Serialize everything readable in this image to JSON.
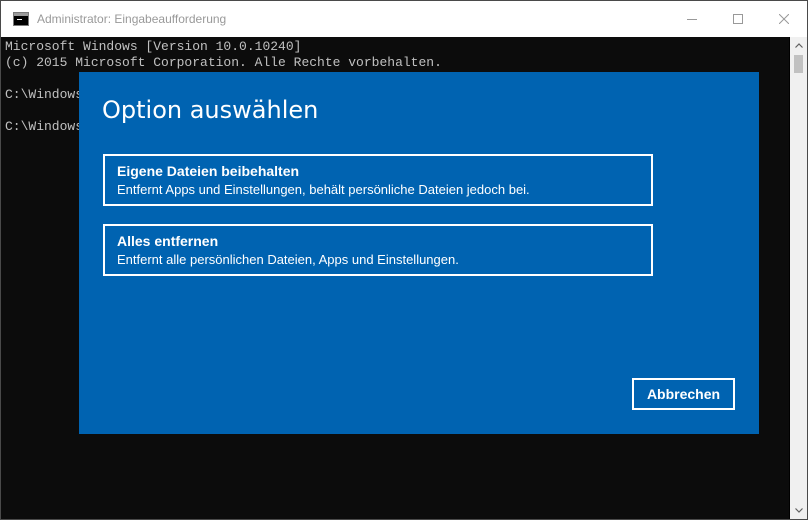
{
  "window": {
    "title": "Administrator: Eingabeaufforderung"
  },
  "console": {
    "lines": [
      "Microsoft Windows [Version 10.0.10240]",
      "(c) 2015 Microsoft Corporation. Alle Rechte vorbehalten.",
      "",
      "C:\\Windows",
      "",
      "C:\\Windows"
    ]
  },
  "dialog": {
    "title": "Option auswählen",
    "options": [
      {
        "title": "Eigene Dateien beibehalten",
        "description": "Entfernt Apps und Einstellungen, behält persönliche Dateien jedoch bei."
      },
      {
        "title": "Alles entfernen",
        "description": "Entfernt alle persönlichen Dateien, Apps und Einstellungen."
      }
    ],
    "cancel_label": "Abbrechen"
  },
  "icons": {
    "app": "command-prompt-icon",
    "minimize": "minimize-icon",
    "maximize": "maximize-icon",
    "close": "close-icon",
    "scroll_up": "chevron-up-icon",
    "scroll_down": "chevron-down-icon"
  },
  "colors": {
    "dialog_background": "#0063b1",
    "console_background": "#0c0c0c",
    "console_text": "#c0c0c0"
  }
}
